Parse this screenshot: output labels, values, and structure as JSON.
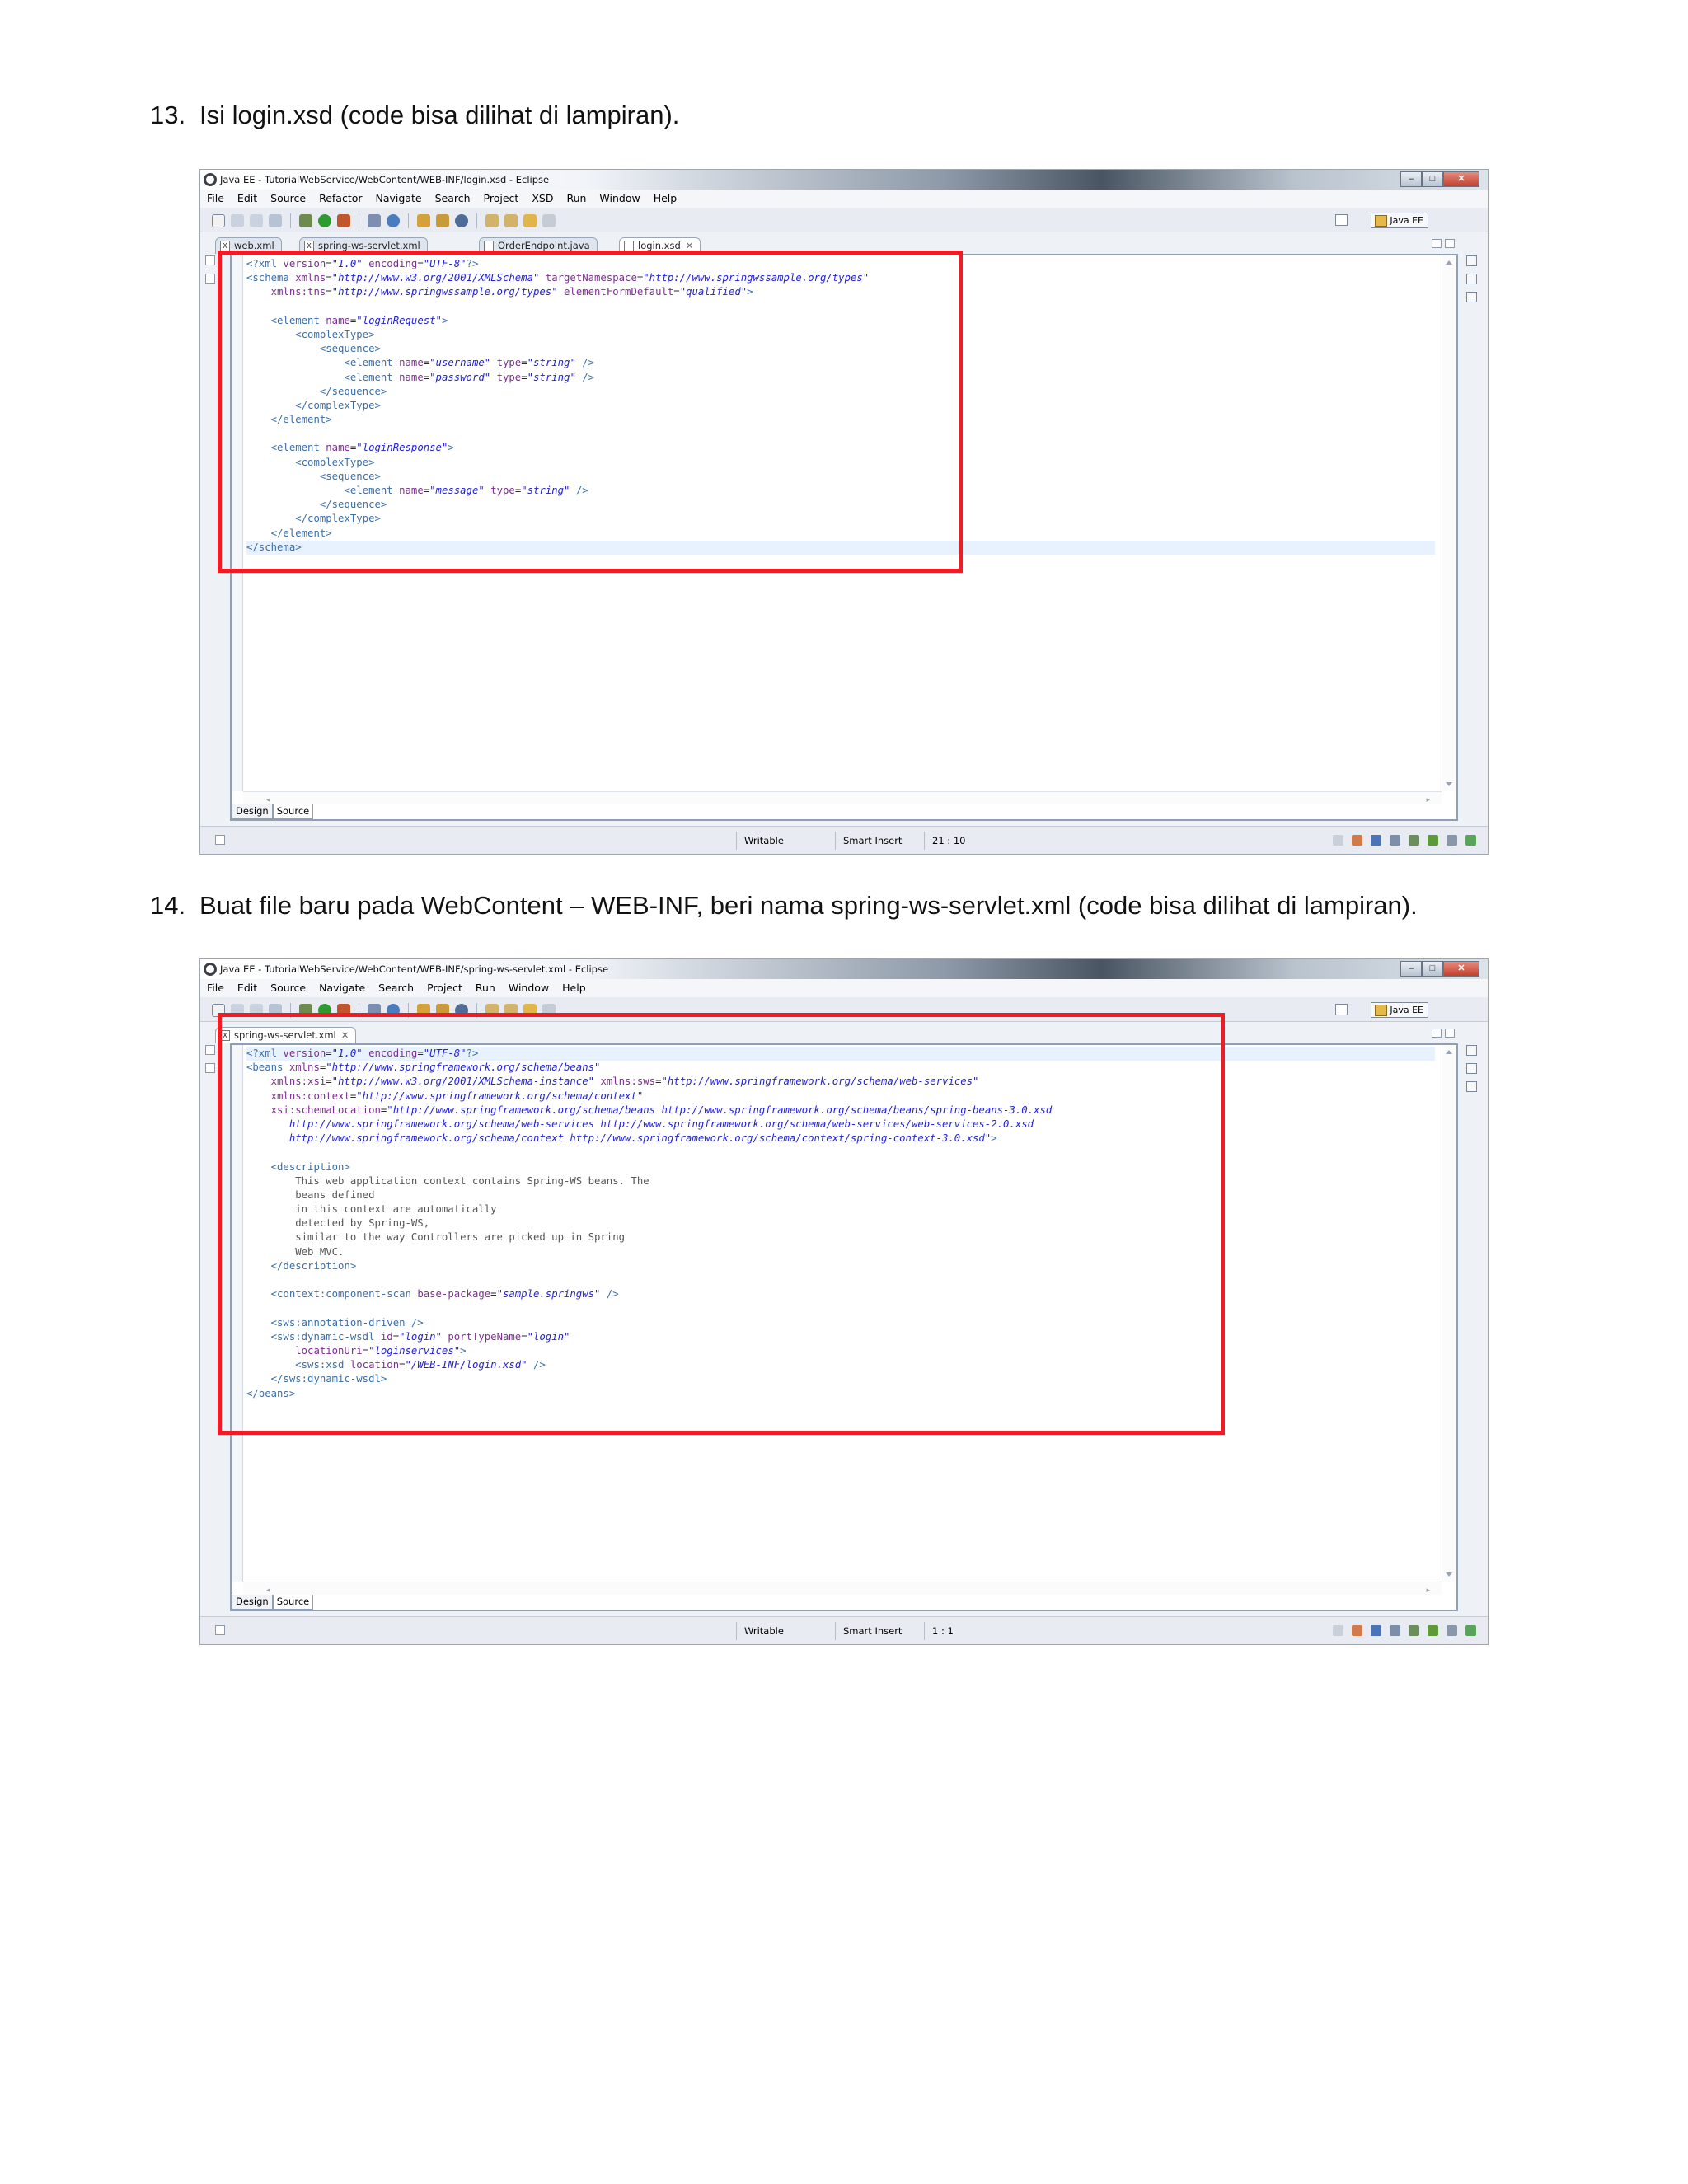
{
  "steps": [
    {
      "number": "13.",
      "text": "Isi login.xsd (code bisa dilihat di lampiran)."
    },
    {
      "number": "14.",
      "text": "Buat file baru pada WebContent – WEB-INF, beri nama spring-ws-servlet.xml (code bisa dilihat di lampiran)."
    }
  ],
  "screenshot1": {
    "window_title": "Java EE - TutorialWebService/WebContent/WEB-INF/login.xsd - Eclipse",
    "menu": [
      "File",
      "Edit",
      "Source",
      "Refactor",
      "Navigate",
      "Search",
      "Project",
      "XSD",
      "Run",
      "Window",
      "Help"
    ],
    "perspective": "Java EE",
    "tabs": [
      "web.xml",
      "spring-ws-servlet.xml",
      "OrderEndpoint.java",
      "login.xsd"
    ],
    "tab_file_icon": "X",
    "editor_tabs": [
      "Design",
      "Source"
    ],
    "status": {
      "writable": "Writable",
      "insert_mode": "Smart Insert",
      "position": "21 : 10"
    }
  },
  "screenshot2": {
    "window_title": "Java EE - TutorialWebService/WebContent/WEB-INF/spring-ws-servlet.xml - Eclipse",
    "menu": [
      "File",
      "Edit",
      "Source",
      "Navigate",
      "Search",
      "Project",
      "Run",
      "Window",
      "Help"
    ],
    "perspective": "Java EE",
    "tabs": [
      "spring-ws-servlet.xml"
    ],
    "tab_file_icon": "X",
    "editor_tabs": [
      "Design",
      "Source"
    ],
    "status": {
      "writable": "Writable",
      "insert_mode": "Smart Insert",
      "position": "1 : 1"
    }
  },
  "window_buttons": {
    "minimize": "–",
    "maximize": "□",
    "close": "✕"
  },
  "icons": {
    "window": "eclipse-logo-icon",
    "tab_close": "close-tab-icon",
    "fold": "fold-collapse-icon",
    "toolbar": [
      "new-icon",
      "save-icon",
      "save-all-icon",
      "print-icon",
      "debug-icon",
      "run-icon",
      "external-tools-icon",
      "new-server-icon",
      "new-class-icon",
      "open-type-icon",
      "search-icon",
      "globe-icon",
      "next-annotation-icon",
      "prev-annotation-icon",
      "back-icon",
      "forward-icon"
    ]
  },
  "colors": {
    "highlight_box": "#ee1c24",
    "xml_tag": "#3b6ea8",
    "xml_attribute": "#7b2f8e",
    "xml_value": "#2222d4"
  }
}
